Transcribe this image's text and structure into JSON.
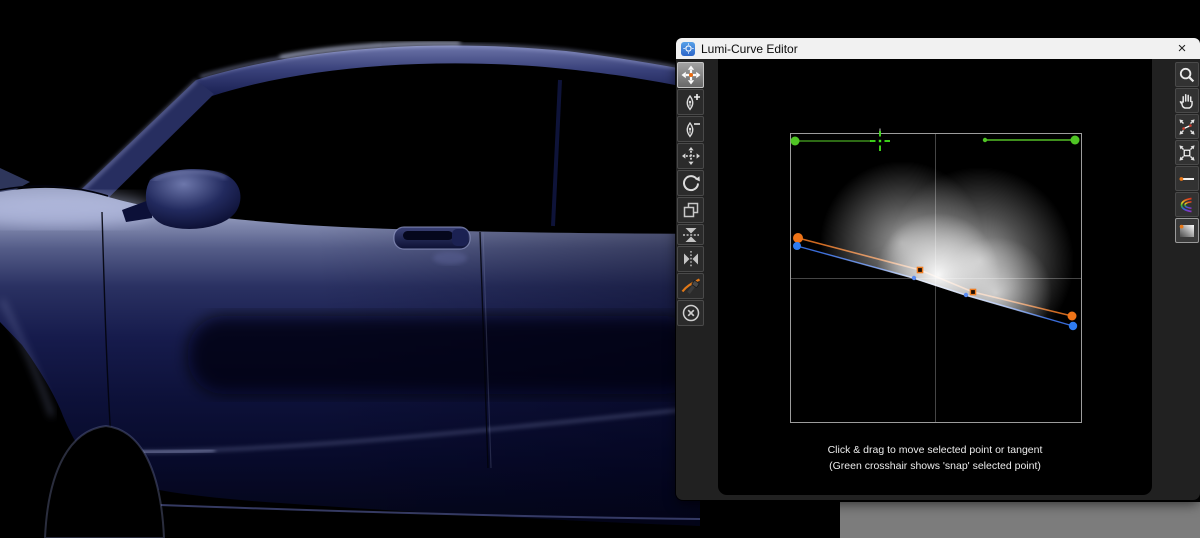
{
  "window": {
    "title": "Lumi-Curve Editor",
    "close_glyph": "×"
  },
  "instructions": {
    "line1": "Click & drag to move selected point or tangent",
    "line2": "(Green crosshair shows 'snap' selected point)"
  },
  "left_toolbar": {
    "tools": [
      {
        "name": "move-point",
        "icon": "move-arrows-icon",
        "active": true
      },
      {
        "name": "add-point",
        "icon": "pen-plus-icon",
        "active": false
      },
      {
        "name": "remove-point",
        "icon": "pen-minus-icon",
        "active": false
      },
      {
        "name": "nudge-point",
        "icon": "dotted-move-icon",
        "active": false
      },
      {
        "name": "rotate-tangent",
        "icon": "rotate-icon",
        "active": false
      },
      {
        "name": "duplicate-point",
        "icon": "overlap-squares-icon",
        "active": false
      },
      {
        "name": "flatten-vertical",
        "icon": "collapse-vertical-icon",
        "active": false
      },
      {
        "name": "flatten-horizontal",
        "icon": "collapse-horizontal-icon",
        "active": false
      },
      {
        "name": "break-tangent",
        "icon": "curve-tool-icon",
        "active": false
      },
      {
        "name": "deselect",
        "icon": "circle-x-icon",
        "active": false
      }
    ]
  },
  "right_toolbar": {
    "tools": [
      {
        "name": "zoom",
        "icon": "magnifier-icon",
        "active": false
      },
      {
        "name": "pan",
        "icon": "hand-icon",
        "active": false
      },
      {
        "name": "frame-curve",
        "icon": "expand-curve-icon",
        "active": false
      },
      {
        "name": "frame-all",
        "icon": "expand-frame-icon",
        "active": false
      },
      {
        "name": "preset-flat-curve",
        "icon": "flat-line-icon",
        "active": false
      },
      {
        "name": "preset-color-curve",
        "icon": "rainbow-curve-icon",
        "active": false
      },
      {
        "name": "preset-gradient",
        "icon": "gradient-swatch-icon",
        "active": true
      }
    ]
  },
  "colors": {
    "curve_primary": "#ef7418",
    "curve_secondary": "#2f7bf0",
    "tangent_green": "#4fc424",
    "titlebar_bg": "#f1f1f1",
    "dialog_bg": "#212121",
    "canvas_bg": "#000000",
    "desktop_gray": "#7c7c7c",
    "car_paint": "#141a4d"
  },
  "curve_editor": {
    "type": "curve-editor",
    "curves": [
      {
        "name": "orange-curve",
        "color": "#ef7418",
        "points_norm": [
          [
            0.027,
            0.36
          ],
          [
            0.445,
            0.47
          ],
          [
            0.627,
            0.545
          ],
          [
            0.968,
            0.63
          ]
        ]
      },
      {
        "name": "blue-curve",
        "color": "#2f7bf0",
        "points_norm": [
          [
            0.024,
            0.388
          ],
          [
            0.425,
            0.498
          ],
          [
            0.603,
            0.557
          ],
          [
            0.972,
            0.663
          ]
        ]
      }
    ],
    "tangent_handles": [
      {
        "name": "left-tangent",
        "from_norm": [
          0.017,
          0.026
        ],
        "to_norm": [
          0.31,
          0.026
        ],
        "has_snap_crosshair": true
      },
      {
        "name": "right-tangent",
        "from_norm": [
          0.67,
          0.023
        ],
        "to_norm": [
          0.965,
          0.023
        ],
        "has_snap_crosshair": false
      }
    ],
    "has_luminance_histogram": true,
    "grid": "center-crosshair"
  }
}
